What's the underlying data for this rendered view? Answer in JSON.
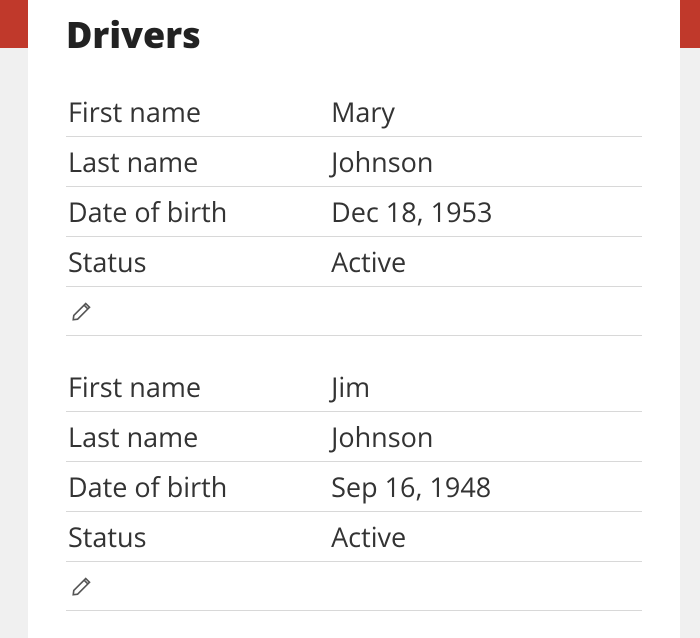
{
  "section": {
    "title": "Drivers"
  },
  "labels": {
    "first_name": "First name",
    "last_name": "Last name",
    "dob": "Date of birth",
    "status": "Status"
  },
  "drivers": [
    {
      "first_name": "Mary",
      "last_name": "Johnson",
      "dob": "Dec 18, 1953",
      "status": "Active"
    },
    {
      "first_name": "Jim",
      "last_name": "Johnson",
      "dob": "Sep 16, 1948",
      "status": "Active"
    }
  ]
}
